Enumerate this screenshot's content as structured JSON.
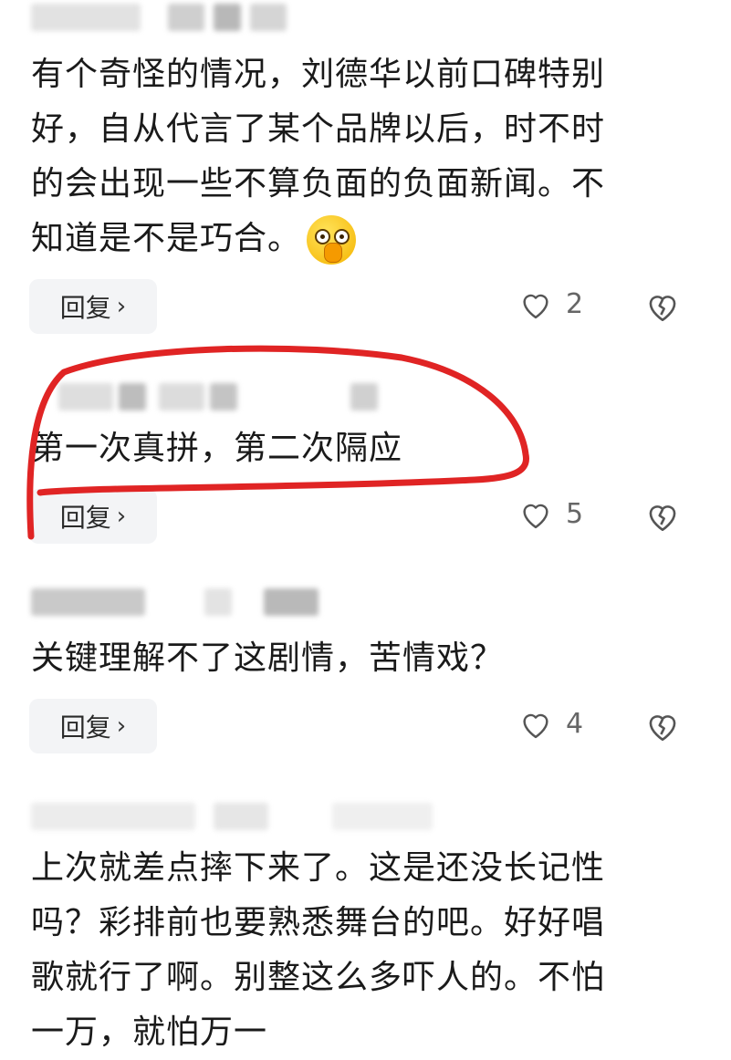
{
  "comments": [
    {
      "text": "有个奇怪的情况，刘德华以前口碑特别\n好，自从代言了某个品牌以后，时不时\n的会出现一些不算负面的负面新闻。不\n知道是不是巧合。",
      "emoji": "shush-face-emoji",
      "reply_label": "回复",
      "likes": "2"
    },
    {
      "text": "第一次真拼，第二次隔应",
      "reply_label": "回复",
      "likes": "5"
    },
    {
      "text": "关键理解不了这剧情，苦情戏？",
      "reply_label": "回复",
      "likes": "4"
    },
    {
      "text": "上次就差点摔下来了。这是还没长记性\n吗？彩排前也要熟悉舞台的吧。好好唱\n歌就行了啊。别整这么多吓人的。不怕\n一万，就怕万一"
    }
  ],
  "colors": {
    "annotation": "#e02424",
    "reply_bg": "#f3f4f6",
    "count": "#666666"
  },
  "icons": {
    "like": "heart-outline-icon",
    "dislike": "broken-heart-icon",
    "reply_arrow": "chevron-right-icon"
  }
}
